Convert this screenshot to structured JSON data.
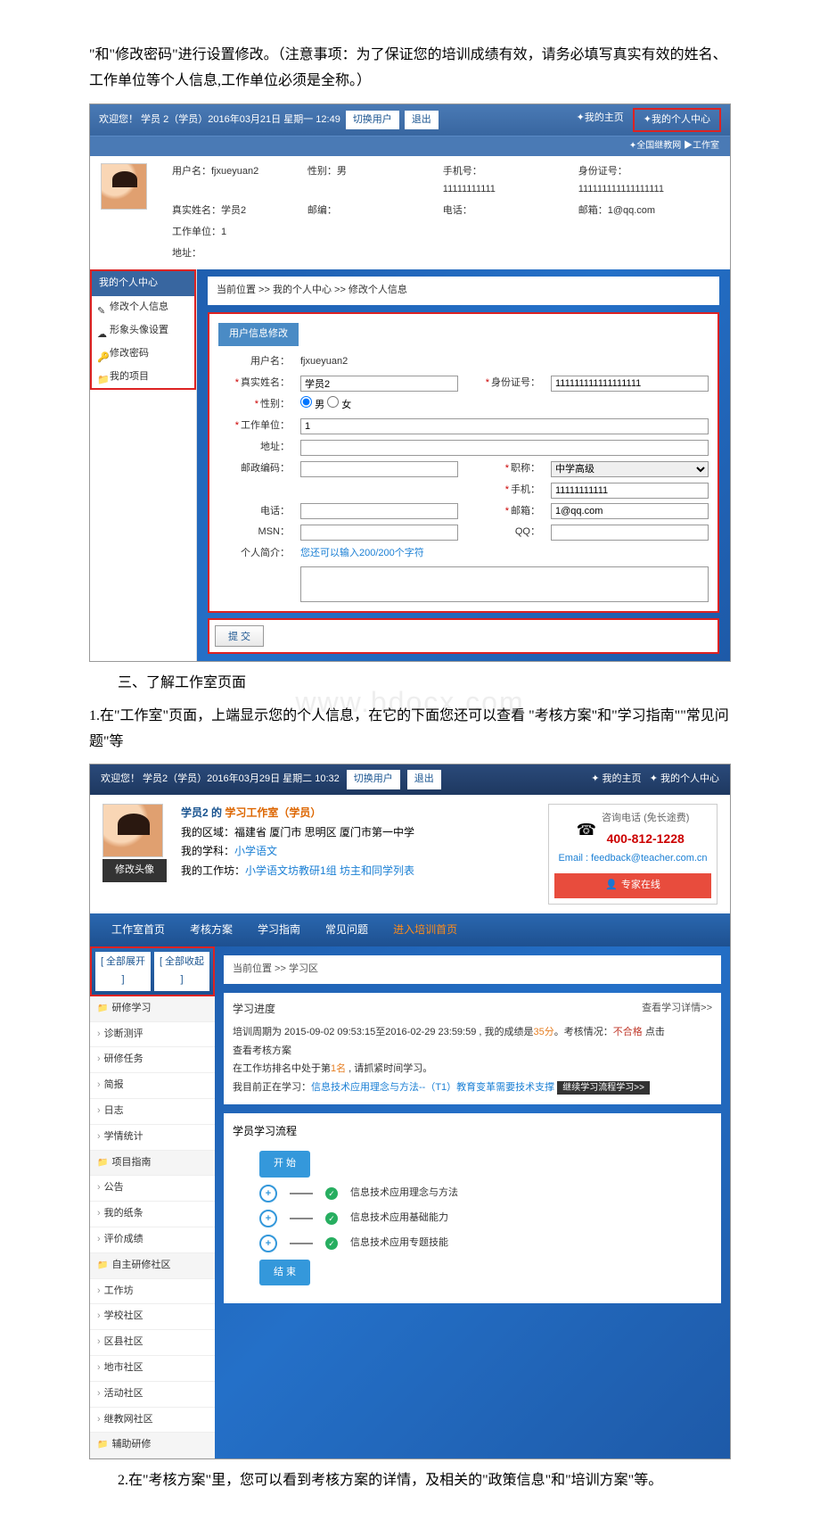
{
  "doc": {
    "intro": "\"和\"修改密码\"进行设置修改。（注意事项：为了保证您的培训成绩有效，请务必填写真实有效的姓名、工作单位等个人信息,工作单位必须是全称。）",
    "section3_title": "三、了解工作室页面",
    "section3_p1": "1.在\"工作室\"页面，上端显示您的个人信息，在它的下面您还可以查看 \"考核方案\"和\"学习指南\"\"常见问题\"等",
    "section3_p2": "2.在\"考核方案\"里，您可以看到考核方案的详情，及相关的\"政策信息\"和\"培训方案\"等。"
  },
  "ss1": {
    "welcome": "欢迎您！ 学员 2（学员）2016年03月21日 星期一 12:49",
    "switch_user": "切换用户",
    "logout": "退出",
    "my_home": "✦我的主页",
    "my_center": "✦我的个人中心",
    "substrip": "✦全国继教网 ▶工作室",
    "info": {
      "username_label": "用户名：",
      "username": "fjxueyuan2",
      "realname_label": "真实姓名：",
      "realname": "学员2",
      "workunit_label": "工作单位：",
      "workunit": "1",
      "address_label": "地址：",
      "gender_label": "性别：",
      "gender": "男",
      "postcode_label": "邮编：",
      "mobile_label": "手机号：",
      "mobile": "11111111111",
      "phone_label": "电话：",
      "idcard_label": "身份证号：",
      "idcard": "111111111111111111",
      "email_label": "邮箱：",
      "email": "1@qq.com"
    },
    "sidebar": {
      "title": "我的个人中心",
      "items": [
        "修改个人信息",
        "形象头像设置",
        "修改密码",
        "我的项目"
      ]
    },
    "breadcrumb": "当前位置 >> 我的个人中心 >> 修改个人信息",
    "panel_title": "用户信息修改",
    "form": {
      "username_label": "用户名：",
      "username": "fjxueyuan2",
      "realname_label": "真实姓名：",
      "realname": "学员2",
      "idcard_label": "身份证号：",
      "idcard": "111111111111111111",
      "gender_label": "性别：",
      "gender_male": "男",
      "gender_female": "女",
      "workunit_label": "工作单位：",
      "workunit": "1",
      "address_label": "地址：",
      "postcode_label": "邮政编码：",
      "jobtitle_label": "职称：",
      "jobtitle": "中学高级",
      "mobile_label": "手机：",
      "mobile": "11111111111",
      "phone_label": "电话：",
      "email_label": "邮箱：",
      "email": "1@qq.com",
      "msn_label": "MSN：",
      "qq_label": "QQ：",
      "bio_label": "个人简介：",
      "bio_placeholder": "您还可以输入200/200个字符"
    },
    "submit": "提 交"
  },
  "ss2": {
    "welcome": "欢迎您！ 学员2（学员）2016年03月29日 星期二 10:32",
    "switch_user": "切换用户",
    "logout": "退出",
    "my_home": "✦ 我的主页",
    "my_center": "✦ 我的个人中心",
    "header": {
      "title_prefix": "学员2 的 ",
      "title": "学习工作室（学员）",
      "region_label": "我的区域：",
      "region": "福建省 厦门市 思明区 厦门市第一中学",
      "subject_label": "我的学科：",
      "subject": "小学语文",
      "workshop_label": "我的工作坊：",
      "workshop": "小学语文坊教研1组 坊主和同学列表",
      "avatar_btn": "修改头像"
    },
    "contact": {
      "consult": "咨询电话 (免长途费)",
      "phone": "400-812-1228",
      "email": "Email : feedback@teacher.com.cn",
      "expert": "专家在线"
    },
    "nav": [
      "工作室首页",
      "考核方案",
      "学习指南",
      "常见问题",
      "进入培训首页"
    ],
    "sidebar": {
      "expand": "[ 全部展开 ]",
      "collapse": "[ 全部收起 ]",
      "groups": [
        {
          "hdr": "研修学习",
          "items": [
            "诊断测评",
            "研修任务",
            "简报",
            "日志",
            "学情统计"
          ]
        },
        {
          "hdr": "项目指南",
          "items": [
            "公告",
            "我的纸条",
            "评价成绩"
          ]
        },
        {
          "hdr": "自主研修社区",
          "items": [
            "工作坊",
            "学校社区",
            "区县社区",
            "地市社区",
            "活动社区",
            "继教网社区"
          ]
        },
        {
          "hdr": "辅助研修",
          "items": []
        }
      ]
    },
    "crumb": "当前位置 >> 学习区",
    "progress": {
      "title": "学习进度",
      "view_more": "查看学习详情>>",
      "period": "培训周期为 2015-09-02 09:53:15至2016-02-29 23:59:59 , 我的成绩是",
      "score": "35分",
      "status_label": "。考核情况：",
      "status": "不合格",
      "click_hint": "  点击",
      "view_plan": "查看考核方案",
      "rank_pre": "在工作坊排名中处于第",
      "rank": "1名",
      "rank_post": " , 请抓紧时间学习。",
      "current_label": "我目前正在学习：",
      "current_course": "信息技术应用理念与方法--（T1）教育变革需要技术支撑",
      "continue": "继续学习流程学习>>"
    },
    "flow": {
      "title": "学员学习流程",
      "start": "开 始",
      "end": "结 束",
      "steps": [
        "信息技术应用理念与方法",
        "信息技术应用基础能力",
        "信息技术应用专题技能"
      ]
    }
  }
}
